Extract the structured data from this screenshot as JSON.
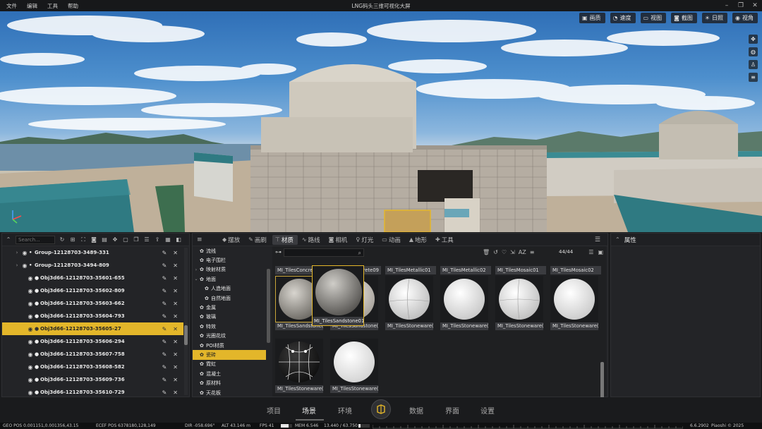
{
  "menubar": {
    "items": [
      "文件",
      "编辑",
      "工具",
      "帮助"
    ],
    "title": "LNG码头三维可视化大屏"
  },
  "viewport": {
    "toolbar": [
      {
        "icon": "image-icon",
        "label": "画质"
      },
      {
        "icon": "speedometer-icon",
        "label": "速度"
      },
      {
        "icon": "view-icon",
        "label": "视图"
      },
      {
        "icon": "camera-icon",
        "label": "截图"
      },
      {
        "icon": "sun-icon",
        "label": "日照"
      },
      {
        "icon": "eye-icon",
        "label": "视角"
      }
    ]
  },
  "outliner": {
    "search_placeholder": "Search...",
    "rows": [
      {
        "type": "group",
        "label": "Group-12128703-3489-331",
        "selected": false
      },
      {
        "type": "group",
        "label": "Group-12128703-3494-809",
        "selected": false
      },
      {
        "type": "object",
        "label": "Obj3d66-12128703-35601-655",
        "selected": false
      },
      {
        "type": "object",
        "label": "Obj3d66-12128703-35602-809",
        "selected": false
      },
      {
        "type": "object",
        "label": "Obj3d66-12128703-35603-662",
        "selected": false
      },
      {
        "type": "object",
        "label": "Obj3d66-12128703-35604-793",
        "selected": false
      },
      {
        "type": "object",
        "label": "Obj3d66-12128703-35605-27",
        "selected": true
      },
      {
        "type": "object",
        "label": "Obj3d66-12128703-35606-294",
        "selected": false
      },
      {
        "type": "object",
        "label": "Obj3d66-12128703-35607-758",
        "selected": false
      },
      {
        "type": "object",
        "label": "Obj3d66-12128703-35608-582",
        "selected": false
      },
      {
        "type": "object",
        "label": "Obj3d66-12128703-35609-736",
        "selected": false
      },
      {
        "type": "object",
        "label": "Obj3d66-12128703-35610-729",
        "selected": false
      }
    ]
  },
  "assets": {
    "tabs": [
      {
        "icon": "place-icon",
        "label": "摆放",
        "active": false
      },
      {
        "icon": "brush-icon",
        "label": "画刷",
        "active": false
      },
      {
        "icon": "material-icon",
        "label": "材质",
        "active": true
      },
      {
        "icon": "route-icon",
        "label": "路线",
        "active": false
      },
      {
        "icon": "camera-icon",
        "label": "相机",
        "active": false
      },
      {
        "icon": "light-icon",
        "label": "灯光",
        "active": false
      },
      {
        "icon": "animation-icon",
        "label": "动画",
        "active": false
      },
      {
        "icon": "terrain-icon",
        "label": "地形",
        "active": false
      },
      {
        "icon": "wrench-icon",
        "label": "工具",
        "active": false
      }
    ],
    "tree": [
      {
        "label": "流线",
        "indent": 1,
        "arrow": "",
        "active": false
      },
      {
        "label": "电子围栏",
        "indent": 1,
        "arrow": "",
        "active": false
      },
      {
        "label": "映射材质",
        "indent": 0,
        "arrow": "›",
        "active": false
      },
      {
        "label": "地面",
        "indent": 0,
        "arrow": "⌄",
        "active": false
      },
      {
        "label": "人造地面",
        "indent": 2,
        "arrow": "",
        "active": false
      },
      {
        "label": "自然地面",
        "indent": 2,
        "arrow": "",
        "active": false
      },
      {
        "label": "金属",
        "indent": 1,
        "arrow": "",
        "active": false
      },
      {
        "label": "玻璃",
        "indent": 1,
        "arrow": "",
        "active": false
      },
      {
        "label": "特效",
        "indent": 1,
        "arrow": "",
        "active": false
      },
      {
        "label": "光圈花纹",
        "indent": 1,
        "arrow": "",
        "active": false
      },
      {
        "label": "POI材质",
        "indent": 1,
        "arrow": "",
        "active": false
      },
      {
        "label": "瓷砖",
        "indent": 1,
        "arrow": "",
        "active": true
      },
      {
        "label": "霓虹",
        "indent": 1,
        "arrow": "",
        "active": false
      },
      {
        "label": "混凝土",
        "indent": 1,
        "arrow": "",
        "active": false
      },
      {
        "label": "原材料",
        "indent": 1,
        "arrow": "",
        "active": false
      },
      {
        "label": "天花板",
        "indent": 1,
        "arrow": "",
        "active": false
      }
    ],
    "count": "44/44",
    "tiles": [
      {
        "name": "MI_TilesConcrete",
        "label": "",
        "style": "sandstone"
      },
      {
        "name": "MI_TilesConcrete09",
        "label": "MI_TilesSandstone(",
        "style": "sandstone-light"
      },
      {
        "name": "MI_TilesMetallic01",
        "label": "MI_TilesStoneware(",
        "style": "white-seam"
      },
      {
        "name": "MI_TilesMetallic02",
        "label": "MI_TilesStoneware(",
        "style": "white"
      },
      {
        "name": "MI_TilesMosaic01",
        "label": "MI_TilesStoneware(",
        "style": "white-seam"
      },
      {
        "name": "MI_TilesMosaic02",
        "label": "MI_TilesStoneware(",
        "style": "white"
      },
      {
        "name": "",
        "label": "MI_TilesStoneware(",
        "style": "dark-grid"
      },
      {
        "name": "",
        "label": "MI_TilesStoneware(",
        "style": "white"
      }
    ],
    "hover_tile": {
      "label": "MI_TilesSandstone01"
    },
    "under_label": "MI_TilesSandstone("
  },
  "properties": {
    "title": "属性"
  },
  "bottomnav": {
    "items": [
      {
        "label": "项目",
        "active": false
      },
      {
        "label": "场景",
        "active": true
      },
      {
        "label": "环境",
        "active": false
      },
      {
        "label": "数据",
        "active": false
      },
      {
        "label": "界面",
        "active": false
      },
      {
        "label": "设置",
        "active": false
      }
    ]
  },
  "statusbar": {
    "geo_pos": "GEO POS  0.001151,0.001356,43.15",
    "ecef_pos": "ECEF POS  6378180,128,149",
    "dir": "DIR  -058.696°",
    "alt": "ALT  43.146 m",
    "fps": "FPS  41",
    "mem": "MEM  6.546",
    "mem_ratio": "13.440 / 63.750",
    "version": "6.6.2902",
    "copyright": "Piaoshi © 2025",
    "fps_fill": 0.7,
    "mem_fill": 0.21
  }
}
